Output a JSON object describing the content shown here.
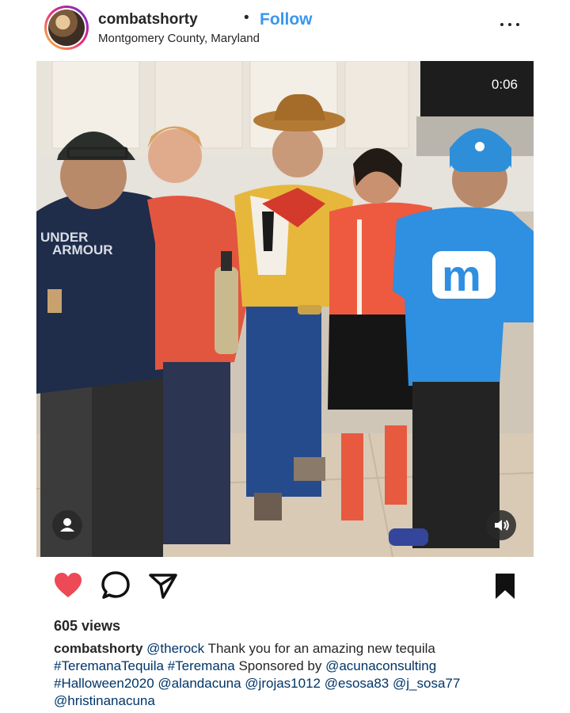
{
  "post": {
    "username": "combatshorty",
    "separator": "•",
    "follow_label": "Follow",
    "location": "Montgomery County, Maryland"
  },
  "video": {
    "timer": "0:06",
    "shirt_brand_line1": "UNDER",
    "shirt_brand_line2": "ARMOUR",
    "mm_letter": "m"
  },
  "stats": {
    "views": "605 views"
  },
  "caption": {
    "username": "combatshorty",
    "segments": [
      {
        "type": "mention",
        "text": "@therock"
      },
      {
        "type": "text",
        "text": " Thank you for an amazing new tequila "
      },
      {
        "type": "hashtag",
        "text": "#TeremanaTequila"
      },
      {
        "type": "text",
        "text": " "
      },
      {
        "type": "hashtag",
        "text": "#Teremana"
      },
      {
        "type": "text",
        "text": " Sponsored by "
      },
      {
        "type": "mention",
        "text": "@acunaconsulting"
      },
      {
        "type": "text",
        "text": " "
      },
      {
        "type": "hashtag",
        "text": "#Halloween2020"
      },
      {
        "type": "text",
        "text": " "
      },
      {
        "type": "mention",
        "text": "@alandacuna"
      },
      {
        "type": "text",
        "text": " "
      },
      {
        "type": "mention",
        "text": "@jrojas1012"
      },
      {
        "type": "text",
        "text": " "
      },
      {
        "type": "mention",
        "text": "@esosa83"
      },
      {
        "type": "text",
        "text": " "
      },
      {
        "type": "mention",
        "text": "@j_sosa77"
      },
      {
        "type": "text",
        "text": " "
      },
      {
        "type": "mention",
        "text": "@hristinanacuna"
      }
    ]
  },
  "icons": {
    "like": "heart-icon",
    "comment": "comment-icon",
    "share": "share-icon",
    "save": "bookmark-icon",
    "more": "more-icon",
    "tag": "user-tag-icon",
    "audio": "speaker-icon"
  },
  "colors": {
    "like_red": "#ed4956",
    "follow_blue": "#3897f0",
    "link_blue": "#003569"
  }
}
